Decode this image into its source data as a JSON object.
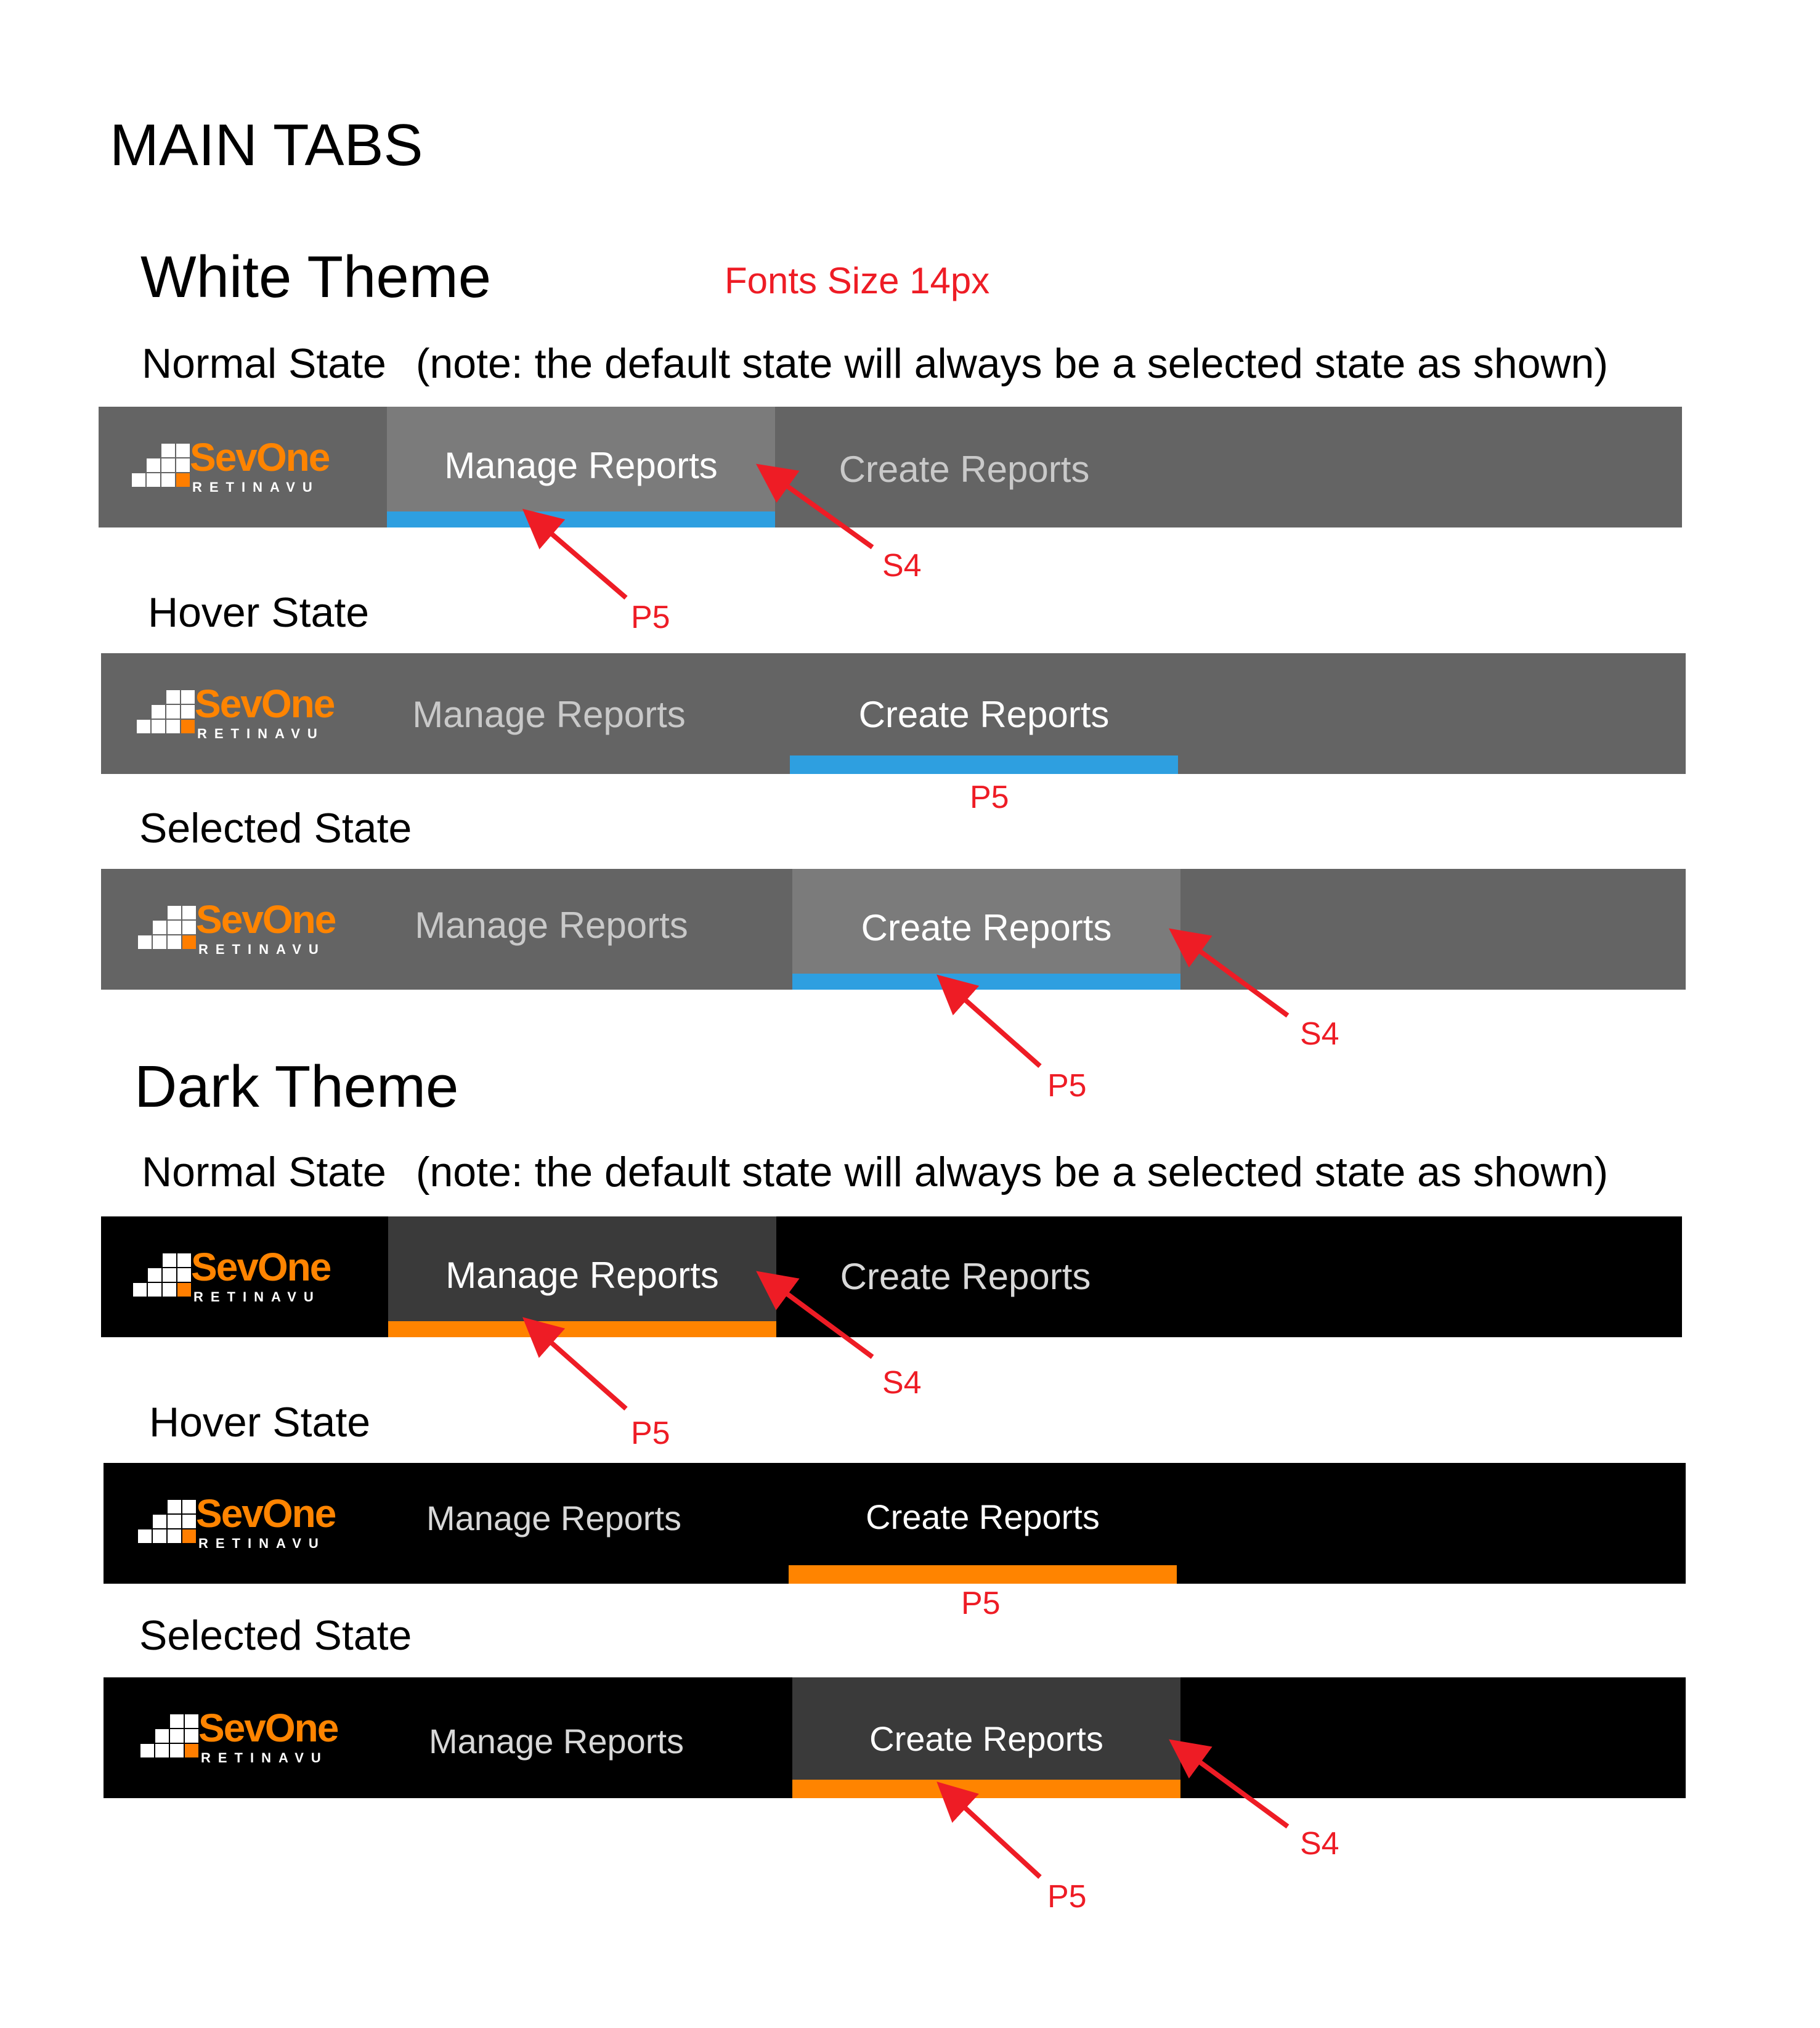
{
  "page": {
    "title": "MAIN TABS",
    "font_note": "Fonts Size 14px",
    "note_text": "(note: the default state will always be a selected state as shown)"
  },
  "colors": {
    "white_bar": "#646464",
    "white_selected_tab": "#7b7b7b",
    "dark_bar": "#000000",
    "dark_selected_tab": "#3a3a3a",
    "white_underline": "#2e9fe0",
    "dark_underline": "#ff8400",
    "logo_orange": "#ff8400",
    "annotation_red": "#ee1c25"
  },
  "logo": {
    "name": "SevOne",
    "sub": "RETINAVU"
  },
  "themes": [
    {
      "heading": "White Theme",
      "states": [
        {
          "label": "Normal State",
          "tabs": [
            "Manage Reports",
            "Create Reports"
          ],
          "callouts": [
            "S4",
            "P5"
          ]
        },
        {
          "label": "Hover State",
          "tabs": [
            "Manage Reports",
            "Create Reports"
          ],
          "callouts": [
            "P5"
          ]
        },
        {
          "label": "Selected State",
          "tabs": [
            "Manage Reports",
            "Create Reports"
          ],
          "callouts": [
            "S4",
            "P5"
          ]
        }
      ]
    },
    {
      "heading": "Dark Theme",
      "states": [
        {
          "label": "Normal State",
          "tabs": [
            "Manage Reports",
            "Create Reports"
          ],
          "callouts": [
            "S4",
            "P5"
          ]
        },
        {
          "label": "Hover State",
          "tabs": [
            "Manage Reports",
            "Create Reports"
          ],
          "callouts": [
            "P5"
          ]
        },
        {
          "label": "Selected State",
          "tabs": [
            "Manage Reports",
            "Create Reports"
          ],
          "callouts": [
            "S4",
            "P5"
          ]
        }
      ]
    }
  ]
}
